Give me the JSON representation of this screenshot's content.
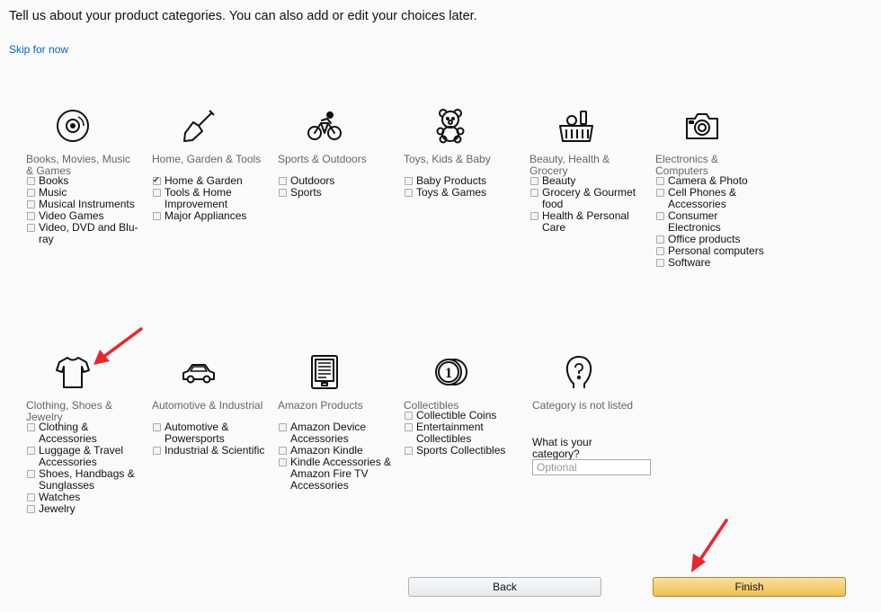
{
  "heading": "Tell us about your product categories. You can also add or edit your choices later.",
  "skip_link": "Skip for now",
  "categories": [
    {
      "title": "Books, Movies, Music & Games",
      "icon": "disc-icon",
      "options": [
        {
          "label": "Books",
          "checked": false
        },
        {
          "label": "Music",
          "checked": false
        },
        {
          "label": "Musical Instruments",
          "checked": false
        },
        {
          "label": "Video Games",
          "checked": false
        },
        {
          "label": "Video, DVD and Blu-ray",
          "checked": false
        }
      ]
    },
    {
      "title": "Home, Garden & Tools",
      "icon": "shovel-icon",
      "options": [
        {
          "label": "Home & Garden",
          "checked": true
        },
        {
          "label": "Tools & Home Improvement",
          "checked": false
        },
        {
          "label": "Major Appliances",
          "checked": false
        }
      ]
    },
    {
      "title": "Sports & Outdoors",
      "icon": "cyclist-icon",
      "options": [
        {
          "label": "Outdoors",
          "checked": false
        },
        {
          "label": "Sports",
          "checked": false
        }
      ]
    },
    {
      "title": "Toys, Kids & Baby",
      "icon": "teddy-bear-icon",
      "options": [
        {
          "label": "Baby Products",
          "checked": false
        },
        {
          "label": "Toys & Games",
          "checked": false
        }
      ]
    },
    {
      "title": "Beauty, Health & Grocery",
      "icon": "grocery-basket-icon",
      "options": [
        {
          "label": "Beauty",
          "checked": false
        },
        {
          "label": "Grocery & Gourmet food",
          "checked": false
        },
        {
          "label": "Health & Personal Care",
          "checked": false
        }
      ]
    },
    {
      "title": "Electronics & Computers",
      "icon": "camera-icon",
      "options": [
        {
          "label": "Camera & Photo",
          "checked": false
        },
        {
          "label": "Cell Phones & Accessories",
          "checked": false
        },
        {
          "label": "Consumer Electronics",
          "checked": false
        },
        {
          "label": "Office products",
          "checked": false
        },
        {
          "label": "Personal computers",
          "checked": false
        },
        {
          "label": "Software",
          "checked": false
        }
      ]
    },
    {
      "title": "Clothing, Shoes & Jewelry",
      "icon": "tshirt-icon",
      "options": [
        {
          "label": "Clothing & Accessories",
          "checked": false
        },
        {
          "label": "Luggage & Travel Accessories",
          "checked": false
        },
        {
          "label": "Shoes, Handbags & Sunglasses",
          "checked": false
        },
        {
          "label": "Watches",
          "checked": false
        },
        {
          "label": "Jewelry",
          "checked": false
        }
      ]
    },
    {
      "title": "Automotive & Industrial",
      "icon": "car-icon",
      "options": [
        {
          "label": "Automotive & Powersports",
          "checked": false
        },
        {
          "label": "Industrial & Scientific",
          "checked": false
        }
      ]
    },
    {
      "title": "Amazon Products",
      "icon": "ereader-icon",
      "options": [
        {
          "label": "Amazon Device Accessories",
          "checked": false
        },
        {
          "label": "Amazon Kindle",
          "checked": false
        },
        {
          "label": "Kindle Accessories & Amazon Fire TV Accessories",
          "checked": false
        }
      ]
    },
    {
      "title": "Collectibles",
      "icon": "coins-icon",
      "options": [
        {
          "label": "Collectible Coins",
          "checked": false
        },
        {
          "label": "Entertainment Collectibles",
          "checked": false
        },
        {
          "label": "Sports Collectibles",
          "checked": false
        }
      ]
    }
  ],
  "not_listed": {
    "title": "Category is not listed",
    "icon": "question-head-icon",
    "prompt": "What is your category?",
    "placeholder": "Optional",
    "value": ""
  },
  "buttons": {
    "back": "Back",
    "finish": "Finish"
  },
  "colors": {
    "link": "#0066c0",
    "finish_button": "#f0c14b",
    "annotation_arrow": "#e8262c"
  }
}
